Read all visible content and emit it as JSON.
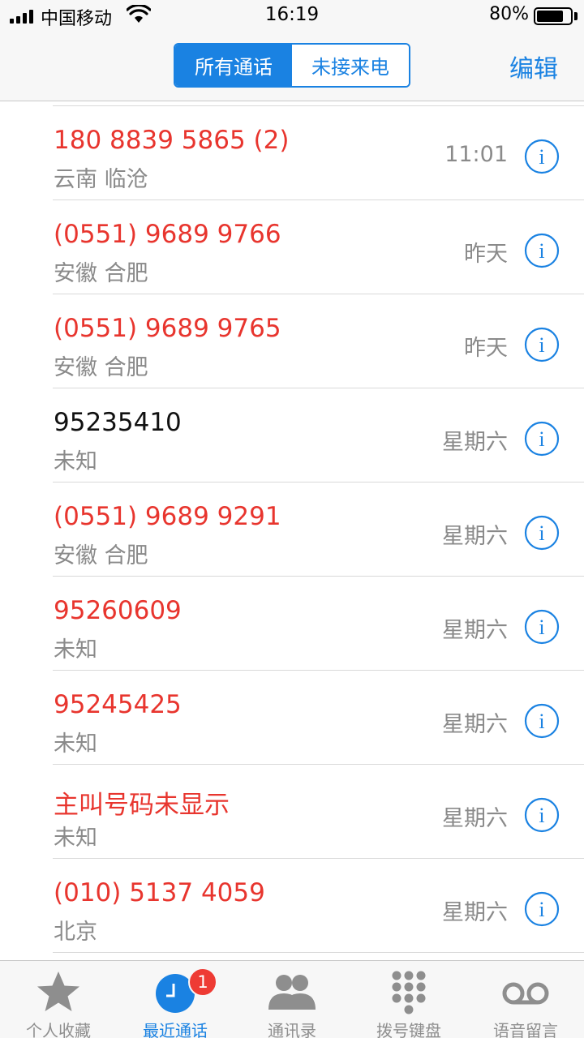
{
  "status_bar": {
    "carrier": "中国移动",
    "time": "16:19",
    "battery_percent": "80%",
    "battery_level": 0.8
  },
  "nav": {
    "segments": [
      "所有通话",
      "未接来电"
    ],
    "active_segment": 0,
    "edit_label": "编辑"
  },
  "calls": [
    {
      "name": "180 8839 5865 (2)",
      "location": "云南 临沧",
      "time": "11:01",
      "missed": true
    },
    {
      "name": "(0551) 9689 9766",
      "location": "安徽 合肥",
      "time": "昨天",
      "missed": true
    },
    {
      "name": "(0551) 9689 9765",
      "location": "安徽 合肥",
      "time": "昨天",
      "missed": true
    },
    {
      "name": "95235410",
      "location": "未知",
      "time": "星期六",
      "missed": false
    },
    {
      "name": "(0551) 9689 9291",
      "location": "安徽 合肥",
      "time": "星期六",
      "missed": true
    },
    {
      "name": "95260609",
      "location": "未知",
      "time": "星期六",
      "missed": true
    },
    {
      "name": "95245425",
      "location": "未知",
      "time": "星期六",
      "missed": true
    },
    {
      "name": "主叫号码未显示",
      "location": "未知",
      "time": "星期六",
      "missed": true
    },
    {
      "name": "(010) 5137 4059",
      "location": "北京",
      "time": "星期六",
      "missed": true
    }
  ],
  "tabs": [
    {
      "label": "个人收藏",
      "icon": "star-icon"
    },
    {
      "label": "最近通话",
      "icon": "clock-icon",
      "badge": "1",
      "active": true
    },
    {
      "label": "通讯录",
      "icon": "contacts-icon"
    },
    {
      "label": "拨号键盘",
      "icon": "keypad-icon"
    },
    {
      "label": "语音留言",
      "icon": "voicemail-icon"
    }
  ],
  "colors": {
    "accent": "#1a82e2",
    "missed": "#e8352e",
    "secondary_text": "#8a8a8a",
    "badge": "#ee3b34"
  }
}
